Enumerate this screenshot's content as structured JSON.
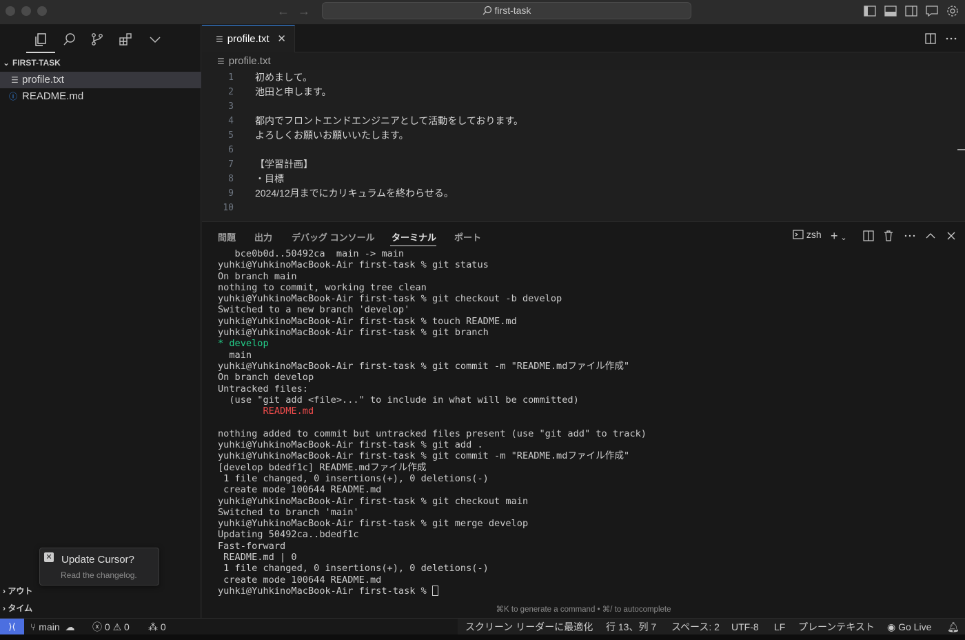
{
  "titlebar": {
    "search_text": "first-task"
  },
  "sidebar": {
    "folder_name": "FIRST-TASK",
    "files": [
      {
        "name": "profile.txt",
        "icon": "lines-file-icon",
        "selected": true
      },
      {
        "name": "README.md",
        "icon": "info-icon",
        "selected": false
      }
    ],
    "bottom_sections": [
      "アウト",
      "タイム"
    ]
  },
  "toast": {
    "title": "Update Cursor?",
    "subtitle": "Read the changelog."
  },
  "editor": {
    "tab_label": "profile.txt",
    "breadcrumb": "profile.txt",
    "lines": [
      {
        "n": "1",
        "text": "初めまして。"
      },
      {
        "n": "2",
        "text": "池田と申します。"
      },
      {
        "n": "3",
        "text": ""
      },
      {
        "n": "4",
        "text": "都内でフロントエンドエンジニアとして活動をしております。"
      },
      {
        "n": "5",
        "text": "よろしくお願いお願いいたします。"
      },
      {
        "n": "6",
        "text": ""
      },
      {
        "n": "7",
        "text": "【学習計画】"
      },
      {
        "n": "8",
        "text": "・目標"
      },
      {
        "n": "9",
        "text": "2024/12月までにカリキュラムを終わらせる。"
      },
      {
        "n": "10",
        "text": ""
      }
    ]
  },
  "panel": {
    "tabs": [
      "問題",
      "出力",
      "デバッグ コンソール",
      "ターミナル",
      "ポート"
    ],
    "active_tab": "ターミナル",
    "shell": "zsh",
    "terminal_lines": [
      "   bce0b0d..50492ca  main -> main",
      "yuhki@YuhkinoMacBook-Air first-task % git status",
      "On branch main",
      "nothing to commit, working tree clean",
      "yuhki@YuhkinoMacBook-Air first-task % git checkout -b develop",
      "Switched to a new branch 'develop'",
      "yuhki@YuhkinoMacBook-Air first-task % touch README.md",
      "yuhki@YuhkinoMacBook-Air first-task % git branch",
      "* develop",
      "  main",
      "yuhki@YuhkinoMacBook-Air first-task % git commit -m \"README.mdファイル作成\"",
      "On branch develop",
      "Untracked files:",
      "  (use \"git add <file>...\" to include in what will be committed)",
      "        README.md",
      "",
      "nothing added to commit but untracked files present (use \"git add\" to track)",
      "yuhki@YuhkinoMacBook-Air first-task % git add .",
      "yuhki@YuhkinoMacBook-Air first-task % git commit -m \"README.mdファイル作成\"",
      "[develop bdedf1c] README.mdファイル作成",
      " 1 file changed, 0 insertions(+), 0 deletions(-)",
      " create mode 100644 README.md",
      "yuhki@YuhkinoMacBook-Air first-task % git checkout main",
      "Switched to branch 'main'",
      "yuhki@YuhkinoMacBook-Air first-task % git merge develop",
      "Updating 50492ca..bdedf1c",
      "Fast-forward",
      " README.md | 0",
      " 1 file changed, 0 insertions(+), 0 deletions(-)",
      " create mode 100644 README.md",
      "yuhki@YuhkinoMacBook-Air first-task % "
    ],
    "hint": "⌘K to generate a command • ⌘/ to autocomplete"
  },
  "statusbar": {
    "branch": "main",
    "errors": "0",
    "warnings": "0",
    "ports": "0",
    "screen_reader": "スクリーン リーダーに最適化",
    "position": "行 13、列 7",
    "spaces": "スペース: 2",
    "encoding": "UTF-8",
    "eol": "LF",
    "language": "プレーンテキスト",
    "go_live": "Go Live"
  },
  "colors": {
    "accent": "#3794ff",
    "remote_bg": "#4c6fe0",
    "terminal_green": "#23d18b",
    "terminal_red": "#f14c4c"
  }
}
